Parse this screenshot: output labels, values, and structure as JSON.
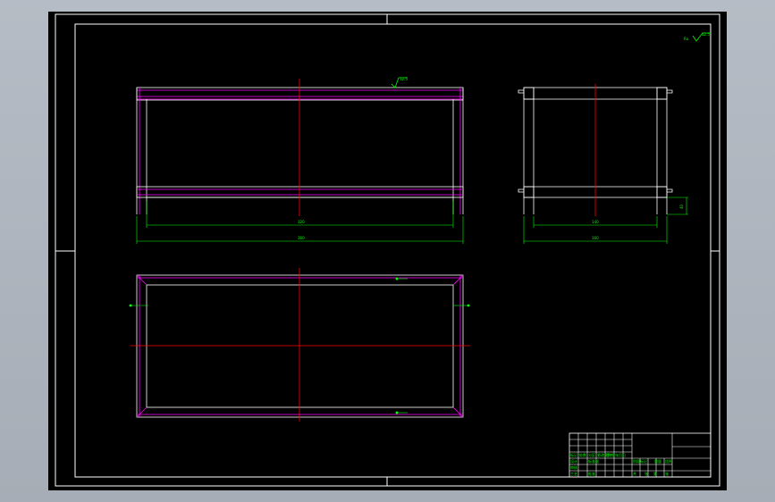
{
  "drawing": {
    "roughness_label": "Ra",
    "roughness_value": "12.5",
    "top_view_roughness_value": "12.5",
    "dimensions": {
      "front_inner_width": "320",
      "front_overall_width": "360",
      "side_inner_width": "140",
      "side_overall_width": "160",
      "side_height": "40"
    },
    "title_block": {
      "labels": [
        "标记",
        "处数",
        "分区",
        "更改文件号",
        "签名",
        "年月日",
        "设计",
        "标准化",
        "阶段标记",
        "重量",
        "比例",
        "审核",
        "工艺",
        "批准",
        "共",
        "张",
        "第",
        "张"
      ]
    },
    "colors": {
      "background": "#000000",
      "frame": "#ffffff",
      "part_outline": "#ff00ff",
      "center_line": "#ff0000",
      "dimension": "#00ff00",
      "window_gray": "#aeb4bd"
    }
  }
}
